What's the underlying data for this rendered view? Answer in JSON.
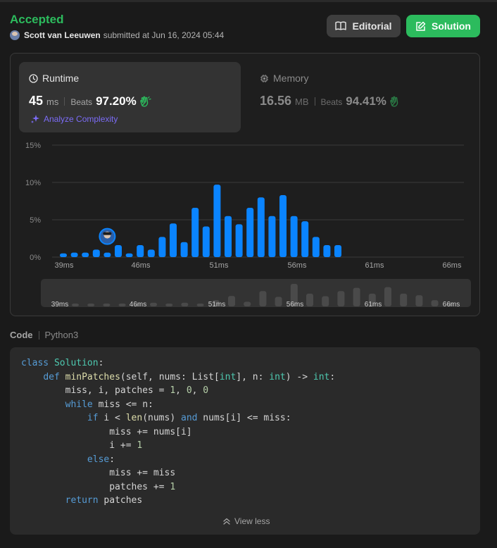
{
  "header": {
    "status": "Accepted",
    "submitter_name": "Scott van Leeuwen",
    "submitted_text": "submitted at Jun 16, 2024 05:44",
    "editorial_label": "Editorial",
    "solution_label": "Solution"
  },
  "runtime": {
    "title": "Runtime",
    "value": "45",
    "unit": "ms",
    "beats_label": "Beats",
    "beats_pct": "97.20%",
    "analyze_label": "Analyze Complexity"
  },
  "memory": {
    "title": "Memory",
    "value": "16.56",
    "unit": "MB",
    "beats_label": "Beats",
    "beats_pct": "94.41%"
  },
  "chart_data": {
    "type": "bar",
    "y_ticks": [
      "15%",
      "10%",
      "5%",
      "0%"
    ],
    "ylim": [
      0,
      15
    ],
    "x_tick_labels": [
      "39ms",
      "46ms",
      "51ms",
      "56ms",
      "61ms",
      "66ms"
    ],
    "values": [
      0.5,
      0.6,
      0.6,
      1.0,
      0.6,
      1.6,
      0.5,
      1.6,
      1.0,
      2.7,
      4.5,
      2.0,
      6.6,
      4.1,
      9.7,
      5.5,
      4.4,
      6.6,
      8.0,
      5.5,
      8.3,
      5.5,
      4.8,
      2.7,
      1.6,
      1.6
    ],
    "user_bar_index": 4,
    "accent_color": "#0a84ff"
  },
  "code": {
    "label": "Code",
    "language": "Python3",
    "view_less_label": "View less"
  },
  "colors": {
    "accepted": "#2cbb5d",
    "bar": "#0a84ff",
    "analyze": "#7b6cf6"
  }
}
